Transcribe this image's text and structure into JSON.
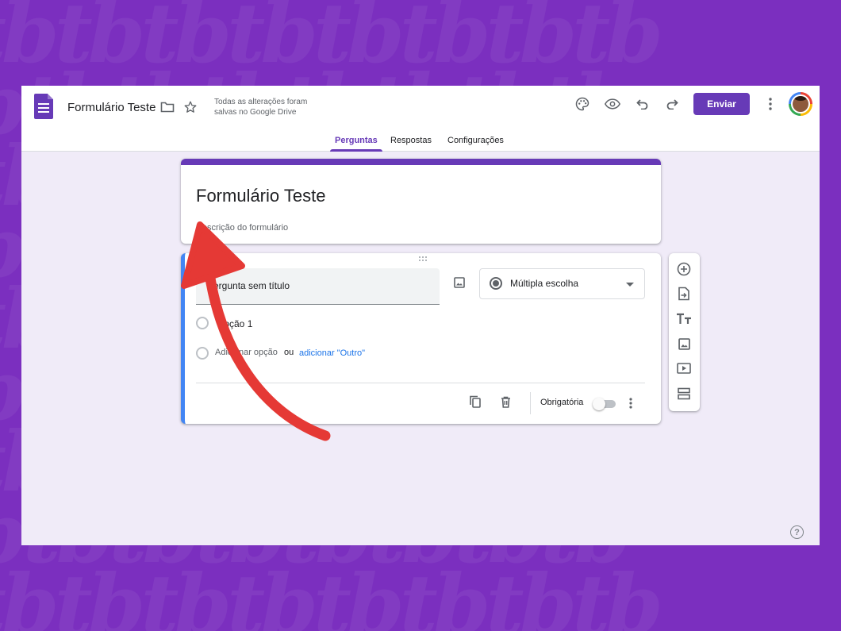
{
  "watermark_text": "tbtbtbtbtbtbtbtb",
  "header": {
    "doc_title": "Formulário Teste",
    "save_status_line1": "Todas as alterações foram",
    "save_status_line2": "salvas no Google Drive",
    "send_label": "Enviar",
    "icons": [
      "forms-logo-icon",
      "folder-icon",
      "star-icon",
      "palette-icon",
      "preview-eye-icon",
      "undo-icon",
      "redo-icon",
      "more-vert-icon",
      "avatar"
    ]
  },
  "tabs": [
    {
      "label": "Perguntas",
      "active": true
    },
    {
      "label": "Respostas",
      "active": false
    },
    {
      "label": "Configurações",
      "active": false
    }
  ],
  "form": {
    "title": "Formulário Teste",
    "description": "Descrição do formulário"
  },
  "question": {
    "title": "Pergunta sem título",
    "type_label": "Múltipla escolha",
    "option_1": "Opção 1",
    "add_option": "Adicionar opção",
    "or_text": "ou",
    "add_other": "adicionar \"Outro\"",
    "required_label": "Obrigatória",
    "required": false
  },
  "side_toolbar": [
    "add-question-icon",
    "import-questions-icon",
    "add-title-icon",
    "add-image-icon",
    "add-video-icon",
    "add-section-icon"
  ],
  "help_symbol": "?",
  "colors": {
    "accent": "#673ab7",
    "background_outer": "#7b2fbf",
    "background_inner": "#f0ebf8",
    "question_highlight": "#4285f4",
    "arrow": "#e53935"
  }
}
